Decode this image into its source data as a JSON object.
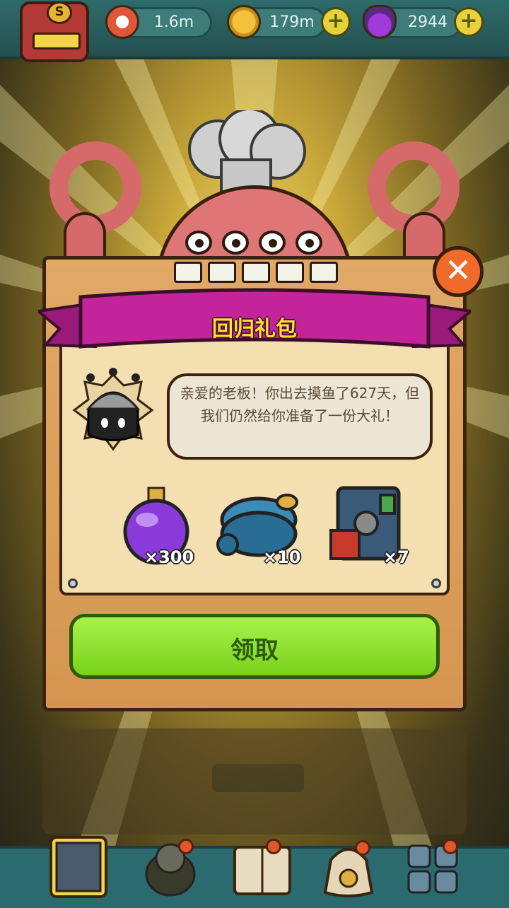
{
  "hud": {
    "eyes": {
      "value": "1.6m",
      "icon": "eyeball-icon"
    },
    "coins": {
      "value": "179m",
      "icon": "coin-icon"
    },
    "potions": {
      "value": "2944",
      "icon": "potion-icon"
    },
    "plus_label": "+",
    "rank_letter": "S"
  },
  "dialog": {
    "title": "回归礼包",
    "close_label": "✕",
    "message": "亲爱的老板！你出去摸鱼了627天，但我们仍然给你准备了一份大礼！",
    "rewards": [
      {
        "icon": "purple-potion-icon",
        "quantity": "×300"
      },
      {
        "icon": "blue-machine-icon",
        "quantity": "×10"
      },
      {
        "icon": "treasure-cabinet-icon",
        "quantity": "×7"
      }
    ],
    "claim_label": "领取"
  },
  "bottom_nav": {
    "items": [
      {
        "icon": "shop-icon"
      },
      {
        "icon": "staff-icon"
      },
      {
        "icon": "book-icon"
      },
      {
        "icon": "bag-icon"
      },
      {
        "icon": "grid-icon"
      }
    ]
  },
  "colors": {
    "ribbon": "#c4249a",
    "claim_button": "#8fe22c",
    "board": "#d99c56",
    "hud": "#2e6b6a"
  }
}
